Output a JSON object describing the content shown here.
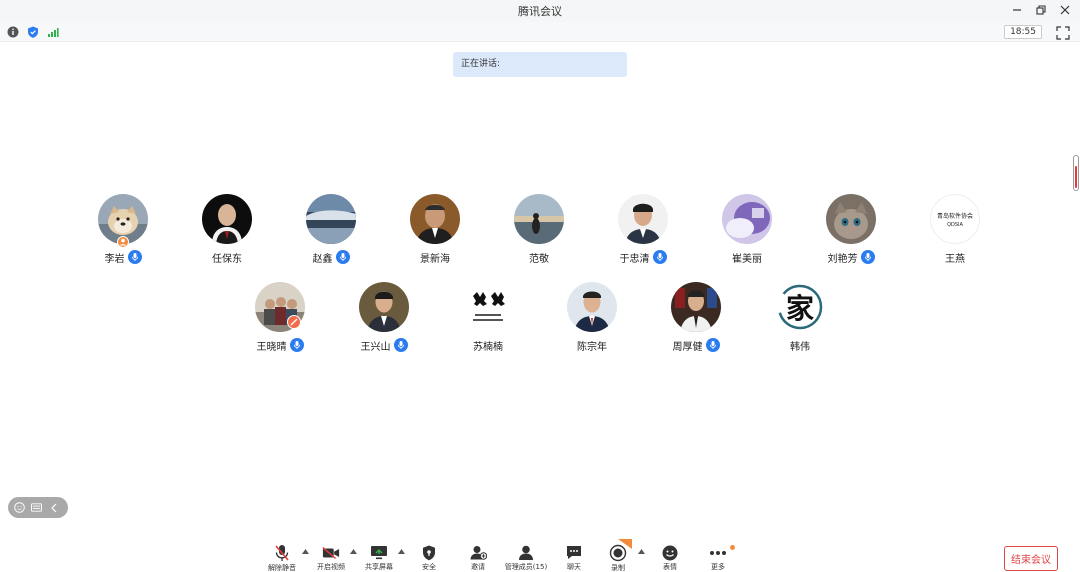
{
  "window": {
    "title": "腾讯会议"
  },
  "status": {
    "clock": "18:55"
  },
  "speaking": {
    "label": "正在讲话:"
  },
  "participants": [
    {
      "name": "李岩",
      "mic": true,
      "host": true
    },
    {
      "name": "任保东",
      "mic": false
    },
    {
      "name": "赵鑫",
      "mic": true
    },
    {
      "name": "景新海",
      "mic": false
    },
    {
      "name": "范敬",
      "mic": false
    },
    {
      "name": "于忠清",
      "mic": true
    },
    {
      "name": "崔美丽",
      "mic": false
    },
    {
      "name": "刘艳芳",
      "mic": true
    },
    {
      "name": "王燕",
      "mic": false,
      "avatar_text": [
        "青岛软件协会",
        "QDSIA"
      ]
    },
    {
      "name": "王晓晴",
      "mic": true
    },
    {
      "name": "王兴山",
      "mic": true
    },
    {
      "name": "苏楠楠",
      "mic": false
    },
    {
      "name": "陈宗年",
      "mic": false
    },
    {
      "name": "周厚健",
      "mic": true
    },
    {
      "name": "韩伟",
      "mic": false,
      "avatar_text": [
        "家"
      ]
    }
  ],
  "toolbar": {
    "unmute": "解除静音",
    "video": "开启视频",
    "share": "共享屏幕",
    "security": "安全",
    "invite": "邀请",
    "members": "管理成员(15)",
    "chat": "聊天",
    "record": "录制",
    "reactions": "表情",
    "more": "更多"
  },
  "end_button": "结束会议",
  "colors": {
    "accent": "#2b7cf0",
    "end": "#e04545",
    "speaking_bg": "#dbe9fb",
    "record_badge": "#f28c3c"
  }
}
